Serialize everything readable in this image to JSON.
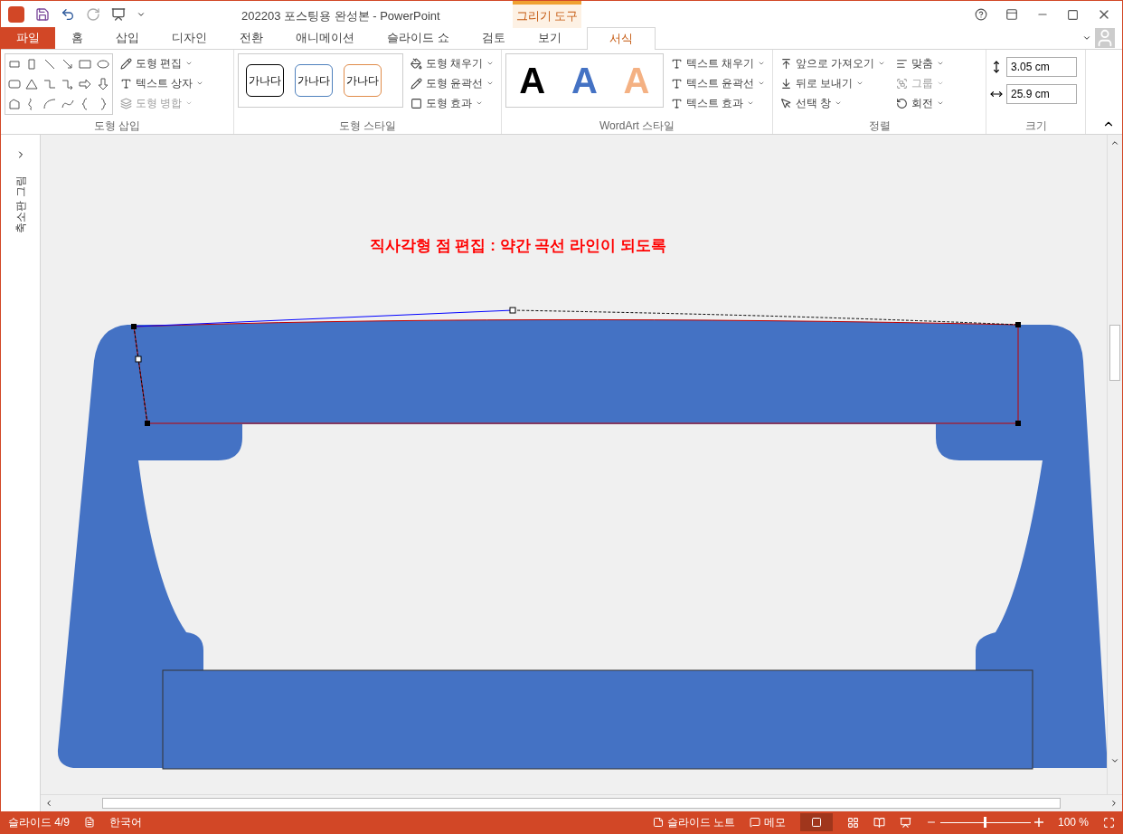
{
  "window": {
    "title": "202203 포스팅용 완성본 - PowerPoint",
    "context_tab": "그리기 도구"
  },
  "tabs": [
    {
      "label": "파일",
      "kind": "file",
      "selected": false
    },
    {
      "label": "홈",
      "kind": "normal",
      "selected": false
    },
    {
      "label": "삽입",
      "kind": "normal",
      "selected": false
    },
    {
      "label": "디자인",
      "kind": "normal",
      "selected": false
    },
    {
      "label": "전환",
      "kind": "normal",
      "selected": false
    },
    {
      "label": "애니메이션",
      "kind": "normal",
      "selected": false
    },
    {
      "label": "슬라이드 쇼",
      "kind": "normal",
      "selected": false
    },
    {
      "label": "검토",
      "kind": "normal",
      "selected": false
    },
    {
      "label": "보기",
      "kind": "normal",
      "selected": false
    },
    {
      "label": "서식",
      "kind": "context",
      "selected": true
    }
  ],
  "ribbon": {
    "insert_shapes": {
      "label": "도형 삽입",
      "commands": [
        {
          "label": "도형 편집",
          "disabled": false
        },
        {
          "label": "텍스트 상자",
          "disabled": false
        },
        {
          "label": "도형 병합",
          "disabled": true
        }
      ]
    },
    "shape_styles": {
      "label": "도형 스타일",
      "samples": [
        {
          "text": "가나다",
          "color": "#000000"
        },
        {
          "text": "가나다",
          "color": "#4f81bd"
        },
        {
          "text": "가나다",
          "color": "#e08c4a"
        }
      ],
      "commands": [
        "도형 채우기",
        "도형 윤곽선",
        "도형 효과"
      ]
    },
    "wordart": {
      "label": "WordArt 스타일",
      "samples": [
        {
          "text": "A",
          "color": "#000000"
        },
        {
          "text": "A",
          "color": "#4472c4"
        },
        {
          "text": "A",
          "color": "#f4b183"
        }
      ],
      "commands": [
        "텍스트 채우기",
        "텍스트 윤곽선",
        "텍스트 효과"
      ]
    },
    "arrange": {
      "label": "정렬",
      "commands": [
        {
          "label": "앞으로 가져오기",
          "disabled": false
        },
        {
          "label": "맞춤",
          "disabled": false
        },
        {
          "label": "뒤로 보내기",
          "disabled": false
        },
        {
          "label": "그룹",
          "disabled": true
        },
        {
          "label": "선택 창",
          "disabled": false
        },
        {
          "label": "회전",
          "disabled": false
        }
      ]
    },
    "size": {
      "label": "크기",
      "height": "3.05 cm",
      "width": "25.9 cm"
    }
  },
  "sidebar": {
    "label": "축소판 그림"
  },
  "slide": {
    "heading": "직사각형 점 편집 : 약간 곡선 라인이 되도록"
  },
  "status_bar": {
    "slide": "슬라이드 4/9",
    "language": "한국어",
    "notes": "슬라이드 노트",
    "comments": "메모",
    "zoom": "100 %",
    "zoom_slider": {
      "level": 0.5
    }
  }
}
